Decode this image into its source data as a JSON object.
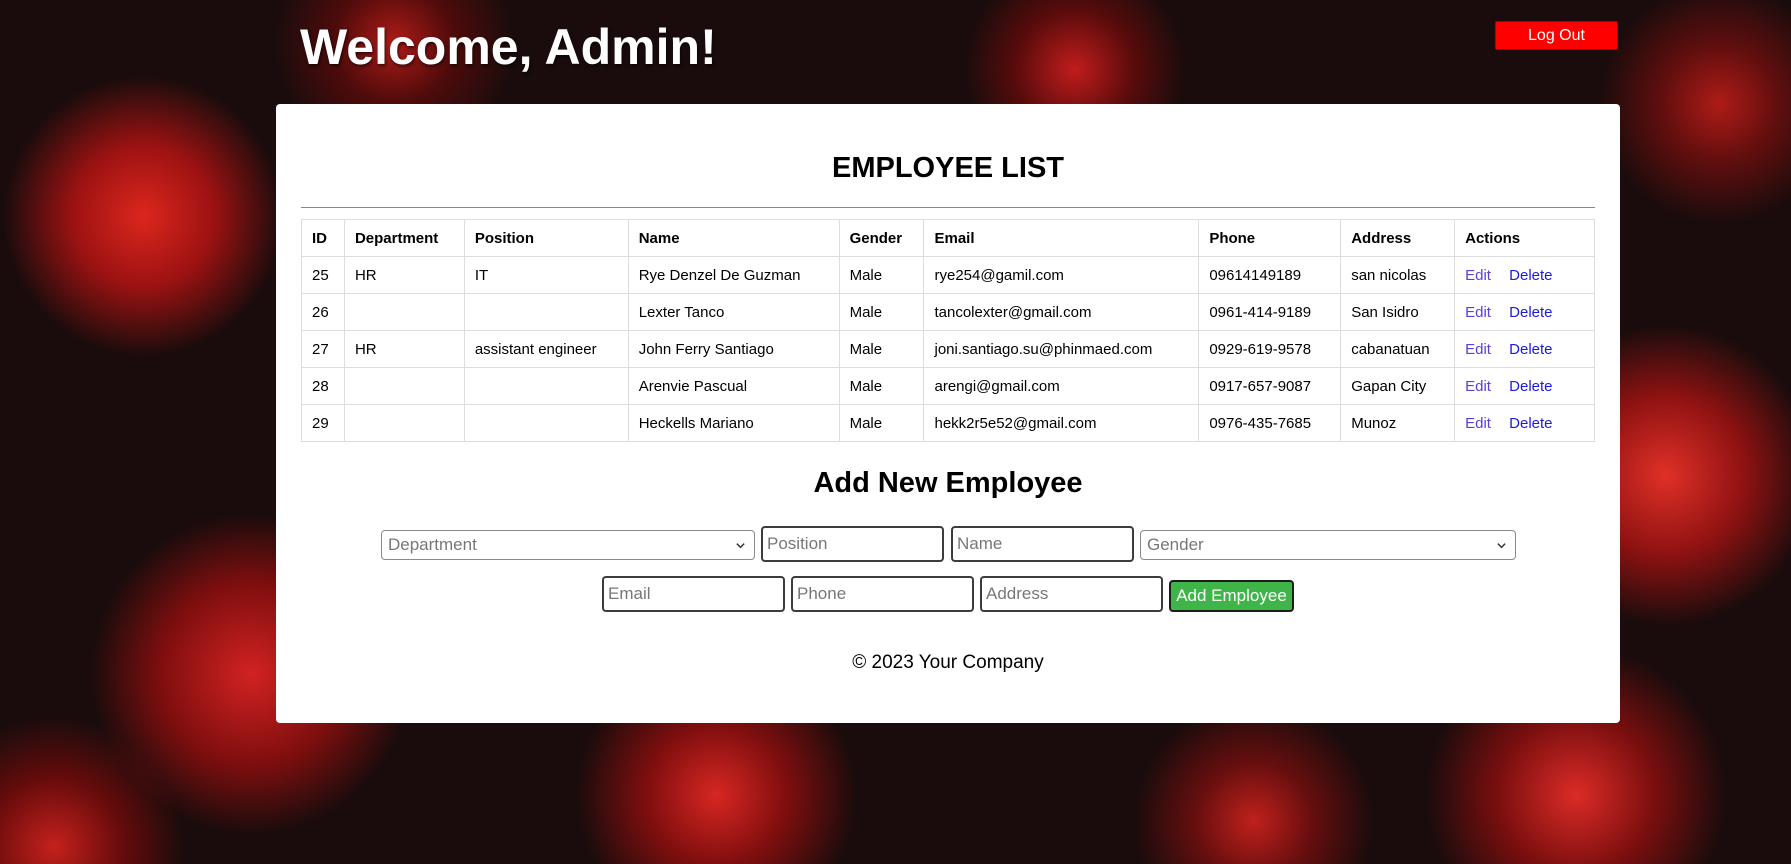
{
  "header": {
    "title": "Welcome, Admin!",
    "logout_label": "Log Out"
  },
  "card": {
    "title": "EMPLOYEE LIST",
    "table": {
      "columns": [
        "ID",
        "Department",
        "Position",
        "Name",
        "Gender",
        "Email",
        "Phone",
        "Address",
        "Actions"
      ],
      "rows": [
        {
          "id": "25",
          "department": "HR",
          "position": "IT",
          "name": "Rye Denzel De Guzman",
          "gender": "Male",
          "email": "rye254@gamil.com",
          "phone": "09614149189",
          "address": "san nicolas"
        },
        {
          "id": "26",
          "department": "",
          "position": "",
          "name": "Lexter Tanco",
          "gender": "Male",
          "email": "tancolexter@gmail.com",
          "phone": "0961-414-9189",
          "address": "San Isidro"
        },
        {
          "id": "27",
          "department": "HR",
          "position": "assistant engineer",
          "name": "John Ferry Santiago",
          "gender": "Male",
          "email": "joni.santiago.su@phinmaed.com",
          "phone": "0929-619-9578",
          "address": "cabanatuan"
        },
        {
          "id": "28",
          "department": "",
          "position": "",
          "name": "Arenvie Pascual",
          "gender": "Male",
          "email": "arengi@gmail.com",
          "phone": "0917-657-9087",
          "address": "Gapan City"
        },
        {
          "id": "29",
          "department": "",
          "position": "",
          "name": "Heckells Mariano",
          "gender": "Male",
          "email": "hekk2r5e52@gmail.com",
          "phone": "0976-435-7685",
          "address": "Munoz"
        }
      ],
      "edit_label": "Edit",
      "delete_label": "Delete"
    }
  },
  "form": {
    "title": "Add New Employee",
    "department_select": "Department",
    "position_placeholder": "Position",
    "name_placeholder": "Name",
    "gender_select": "Gender",
    "email_placeholder": "Email",
    "phone_placeholder": "Phone",
    "address_placeholder": "Address",
    "submit_label": "Add Employee"
  },
  "footer": {
    "text": "© 2023 Your Company"
  },
  "colors": {
    "logout": "#ff0000",
    "add_button": "#3fb549",
    "edit_link": "#5b3fd6",
    "delete_link": "#1a1ae0"
  }
}
